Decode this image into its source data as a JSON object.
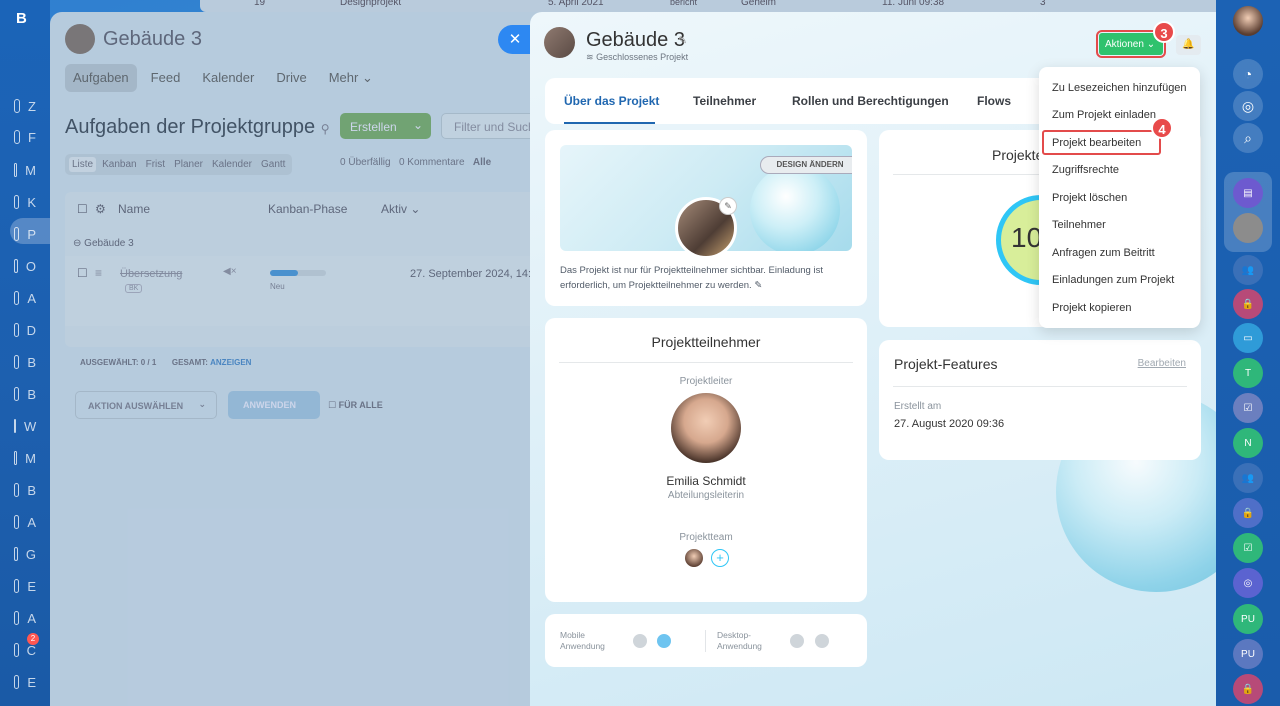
{
  "left_nav": {
    "brand": "B",
    "initials": [
      "Z",
      "F",
      "M",
      "K",
      "P",
      "O",
      "A",
      "D",
      "B",
      "B",
      "W",
      "M",
      "B",
      "A",
      "G",
      "E",
      "A",
      "C",
      "E"
    ],
    "badge": "2"
  },
  "bg_page": {
    "top_row": {
      "num": "19",
      "name": "Designprojekt",
      "date": "5. April 2021",
      "status": "bericht",
      "access": "Geheim",
      "date2": "11. Juni 09:38",
      "count": "3"
    },
    "project": "Gebäude 3",
    "tabs": [
      "Aufgaben",
      "Feed",
      "Kalender",
      "Drive",
      "Mehr"
    ],
    "title": "Aufgaben der Projektgruppe",
    "create_btn": "Erstellen",
    "filter_placeholder": "Filter und Such",
    "view_tabs": [
      "Liste",
      "Kanban",
      "Frist",
      "Planer",
      "Kalender",
      "Gantt"
    ],
    "overdue_count": "0",
    "overdue_label": "Überfällig",
    "comments_count": "0",
    "comments_label": "Kommentare",
    "all_label": "Alle",
    "columns": [
      "Name",
      "Kanban-Phase",
      "Aktiv"
    ],
    "group": "Gebäude 3",
    "task": {
      "name": "Übersetzung",
      "tag": "BK",
      "phase": "Neu",
      "date": "27. September 2024, 14:"
    },
    "selected_label": "AUSGEWÄHLT:",
    "selected_value": "0 / 1",
    "total_label": "GESAMT:",
    "total_link": "ANZEIGEN",
    "action_select": "AKTION AUSWÄHLEN",
    "apply_btn": "ANWENDEN",
    "for_all": "FÜR ALLE"
  },
  "slider": {
    "title": "Gebäude 3",
    "subtitle": "Geschlossenes Projekt",
    "aktionen": "Aktionen",
    "tabs": [
      "Über das Projekt",
      "Teilnehmer",
      "Rollen und Berechtigungen",
      "Flows"
    ],
    "design_btn": "DESIGN ÄNDERN",
    "privacy_text": "Das Projekt ist nur für Projektteilnehmer sichtbar. Einladung ist erforderlich, um Projektteilnehmer zu werden.",
    "members_title": "Projektteilnehmer",
    "leader_label": "Projektleiter",
    "leader_name": "Emilia Schmidt",
    "leader_role": "Abteilungsleiterin",
    "team_label": "Projektteam",
    "mobile_label_1": "Mobile",
    "mobile_label_2": "Anwendung",
    "desktop_label_1": "Desktop-",
    "desktop_label_2": "Anwendung",
    "progress_title": "Projekte",
    "progress_value": "10",
    "features_title": "Projekt-Features",
    "features_edit": "Bearbeiten",
    "created_label": "Erstellt am",
    "created_value": "27. August 2020 09:36"
  },
  "menu": {
    "items": [
      "Zu Lesezeichen hinzufügen",
      "Zum Projekt einladen",
      "Projekt bearbeiten",
      "Zugriffsrechte",
      "Projekt löschen",
      "Teilnehmer",
      "Anfragen zum Beitritt",
      "Einladungen zum Projekt",
      "Projekt kopieren"
    ]
  },
  "steps": [
    "3",
    "4"
  ],
  "right_nav": {
    "initials": [
      "T",
      "N",
      "PU",
      "PU"
    ]
  },
  "colors": {
    "accent_green": "#2fc26d",
    "highlight_red": "#e34b4b",
    "link_blue": "#2067b0"
  }
}
